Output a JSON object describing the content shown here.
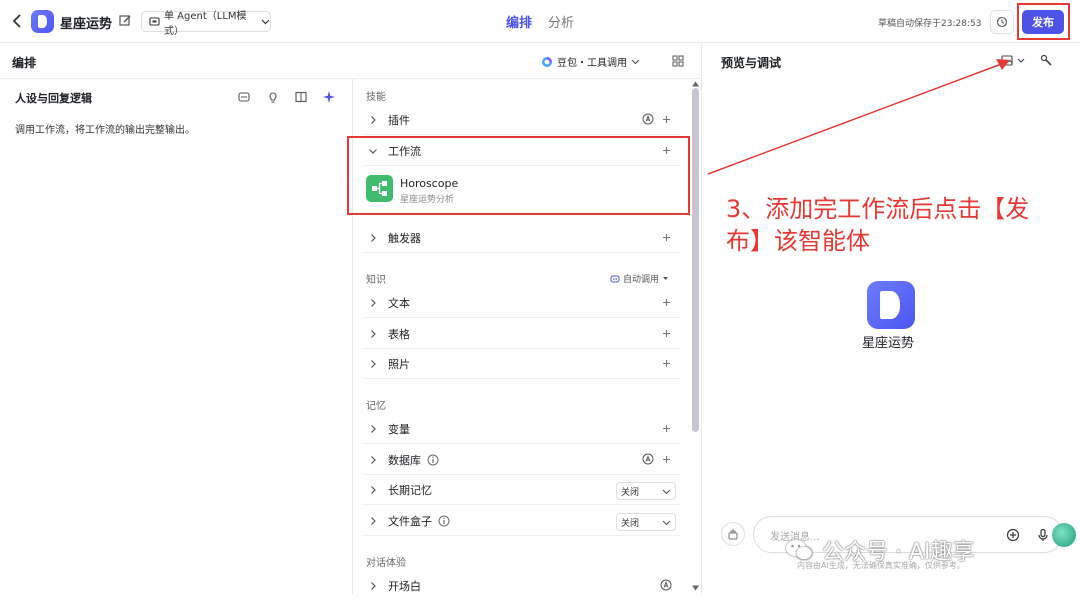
{
  "topbar": {
    "bot_name": "星座运势",
    "agent_mode": "单 Agent（LLM模式）",
    "tabs": [
      "编排",
      "分析"
    ],
    "autosave": "草稿自动保存于23:28:53",
    "publish": "发布"
  },
  "arrange": {
    "title": "编排",
    "model": "豆包・工具调用"
  },
  "persona": {
    "title": "人设与回复逻辑",
    "text": "调用工作流，将工作流的输出完整输出。"
  },
  "skills": {
    "heading": "技能",
    "plugins": "插件",
    "workflow": "工作流",
    "workflow_item": {
      "name": "Horoscope",
      "desc": "星座运势分析"
    },
    "trigger": "触发器"
  },
  "knowledge": {
    "heading": "知识",
    "auto_call": "自动调用",
    "items": [
      "文本",
      "表格",
      "照片"
    ]
  },
  "memory": {
    "heading": "记忆",
    "variables": "变量",
    "database": "数据库",
    "long_term": "长期记忆",
    "long_term_value": "关闭",
    "filebox": "文件盒子",
    "filebox_value": "关闭"
  },
  "dialog": {
    "heading": "对话体验",
    "opening": "开场白"
  },
  "preview": {
    "title": "预览与调试",
    "bot_name": "星座运势",
    "input_placeholder": "发送消息...",
    "disclaimer": "内容由AI生成，无法确保真实准确，仅供参考。"
  },
  "annotation": "3、添加完工作流后点击【发布】该智能体",
  "watermark": "公众号 · AI趣享",
  "colors": {
    "accent": "#4d53e8",
    "annotation": "#e53935",
    "workflow_icon": "#3fbc6e"
  },
  "icons": [
    "back-icon",
    "edit-icon",
    "agent-icon",
    "history-icon",
    "grid-icon",
    "chevron-down-icon",
    "chevron-right-icon",
    "plus-icon",
    "info-icon",
    "wrench-icon",
    "brush-icon",
    "add-circle-icon",
    "mic-icon",
    "wechat-icon"
  ]
}
